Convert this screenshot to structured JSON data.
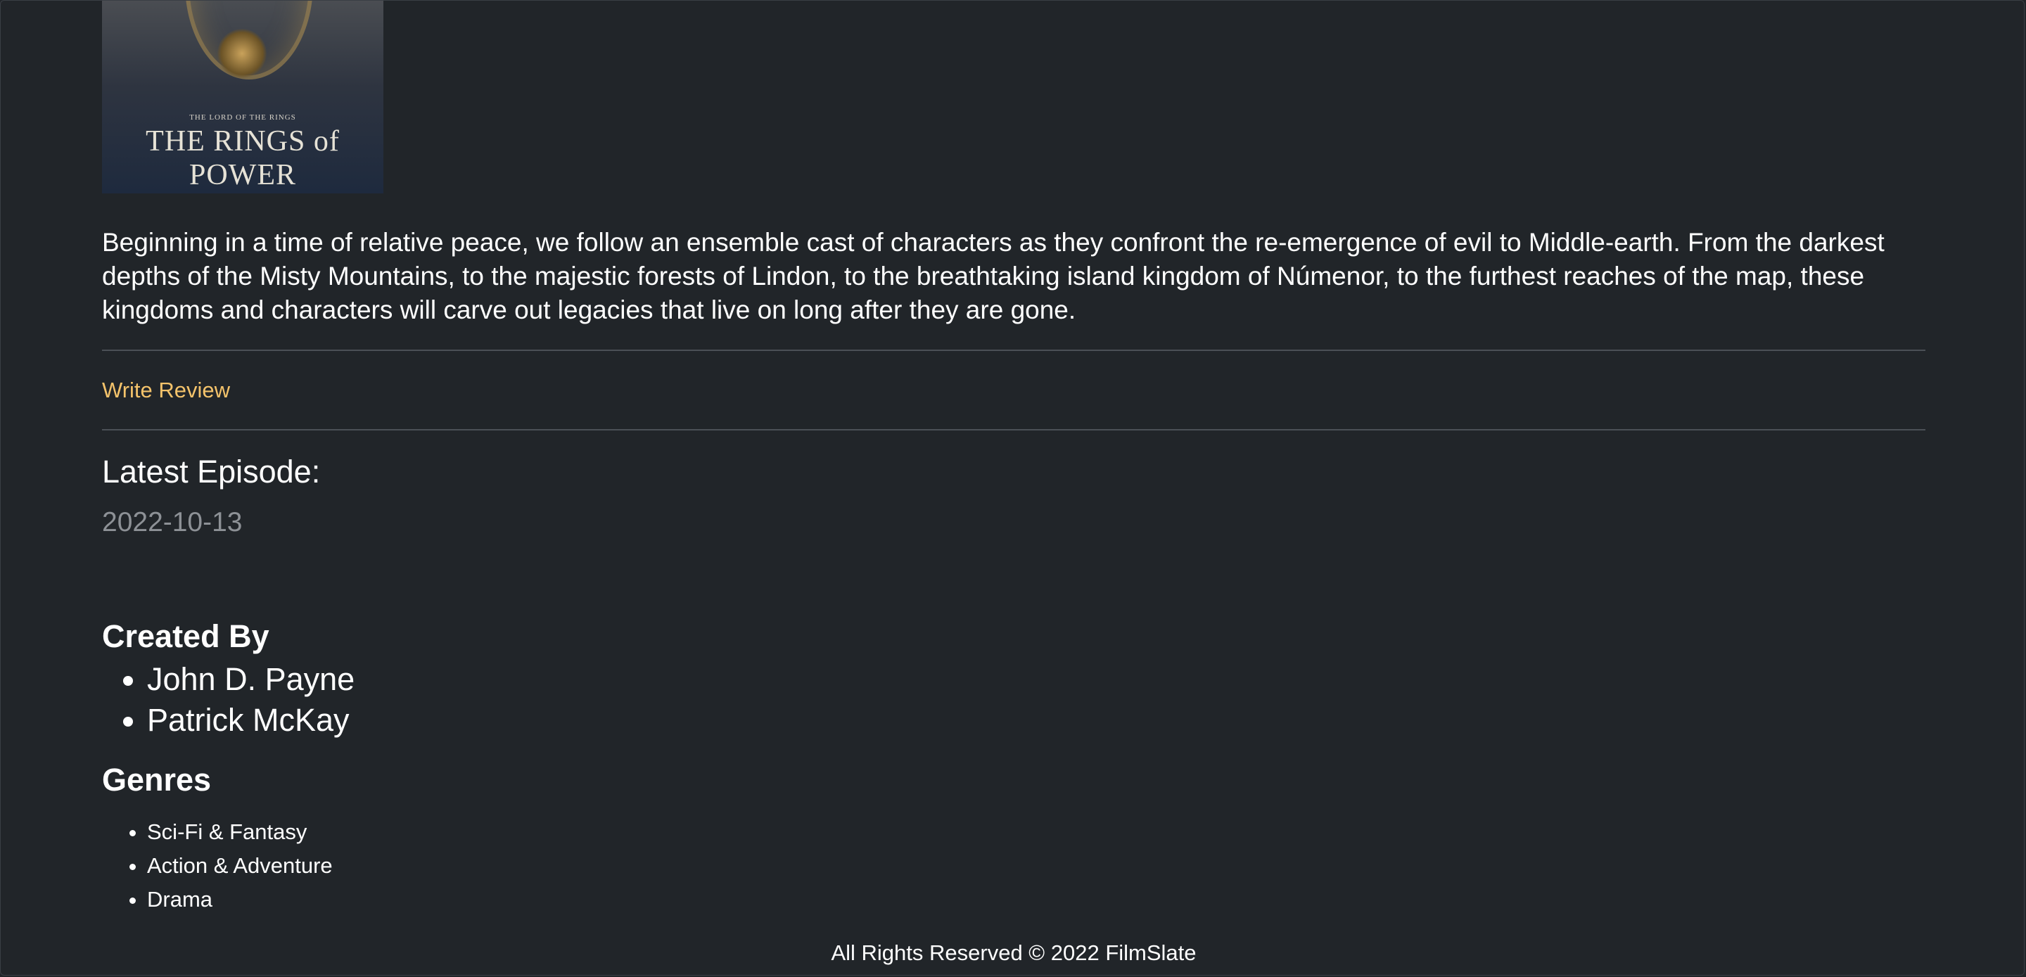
{
  "poster": {
    "small_title": "THE LORD OF THE RINGS",
    "big_title": "THE RINGS of POWER"
  },
  "overview": "Beginning in a time of relative peace, we follow an ensemble cast of characters as they confront the re-emergence of evil to Middle-earth. From the darkest depths of the Misty Mountains, to the majestic forests of Lindon, to the breathtaking island kingdom of Númenor, to the furthest reaches of the map, these kingdoms and characters will carve out legacies that live on long after they are gone.",
  "actions": {
    "write_review": "Write Review"
  },
  "latest_episode": {
    "heading": "Latest Episode:",
    "date": "2022-10-13"
  },
  "created_by": {
    "heading": "Created By",
    "names": [
      "John D. Payne",
      "Patrick McKay"
    ]
  },
  "genres": {
    "heading": "Genres",
    "items": [
      "Sci-Fi & Fantasy",
      "Action & Adventure",
      "Drama"
    ]
  },
  "footer": {
    "text": "All Rights Reserved © 2022 FilmSlate"
  },
  "colors": {
    "background": "#212529",
    "link": "#f4c36b",
    "muted": "#8d9196",
    "divider": "#4b5056"
  }
}
